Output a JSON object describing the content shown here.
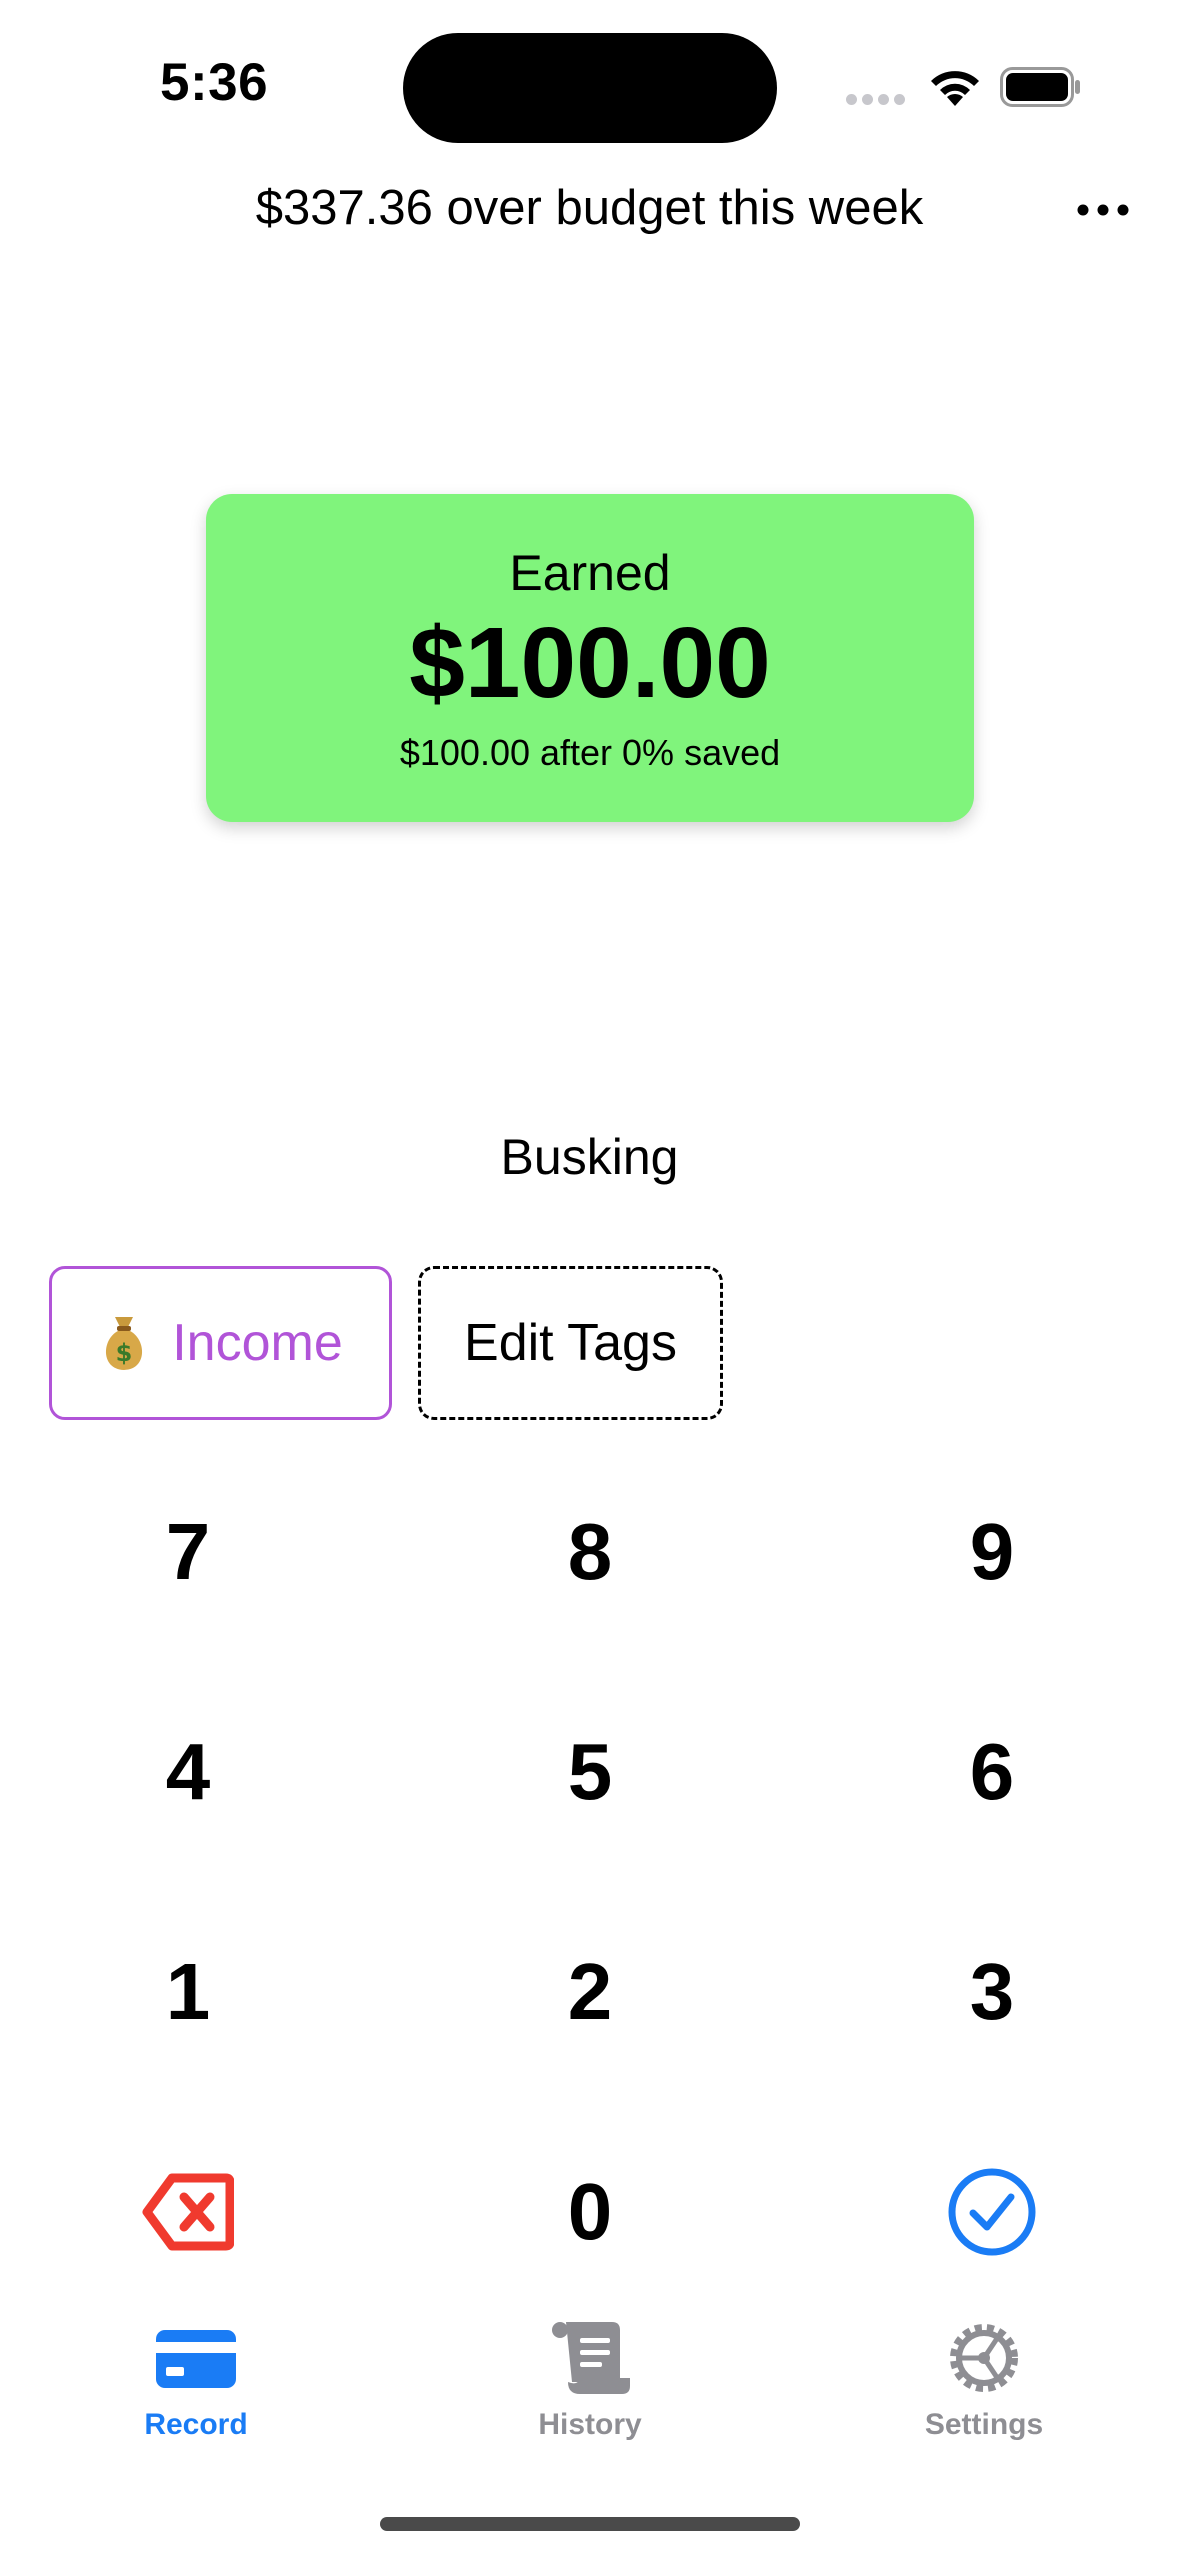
{
  "status_bar": {
    "time": "5:36"
  },
  "header": {
    "budget_status": "$337.36 over budget this week",
    "more_icon": "ellipsis-icon"
  },
  "summary_card": {
    "label": "Earned",
    "amount": "$100.00",
    "detail": "$100.00 after 0% saved",
    "background_color": "#80f47c"
  },
  "note": "Busking",
  "tags": {
    "income": {
      "emoji_icon": "money-bag-icon",
      "label": "Income",
      "color": "#b154d8"
    },
    "edit_label": "Edit Tags"
  },
  "keypad": {
    "keys": [
      "7",
      "8",
      "9",
      "4",
      "5",
      "6",
      "1",
      "2",
      "3"
    ],
    "zero": "0",
    "delete_icon": "delete-backward-icon",
    "confirm_icon": "checkmark-circle-icon",
    "delete_color": "#f03a2e",
    "confirm_color": "#1a7cf5"
  },
  "tab_bar": {
    "tabs": [
      {
        "label": "Record",
        "icon": "credit-card-icon",
        "active": true
      },
      {
        "label": "History",
        "icon": "scroll-icon",
        "active": false
      },
      {
        "label": "Settings",
        "icon": "gear-icon",
        "active": false
      }
    ],
    "active_color": "#1a7cf5",
    "inactive_color": "#8e8e93"
  }
}
